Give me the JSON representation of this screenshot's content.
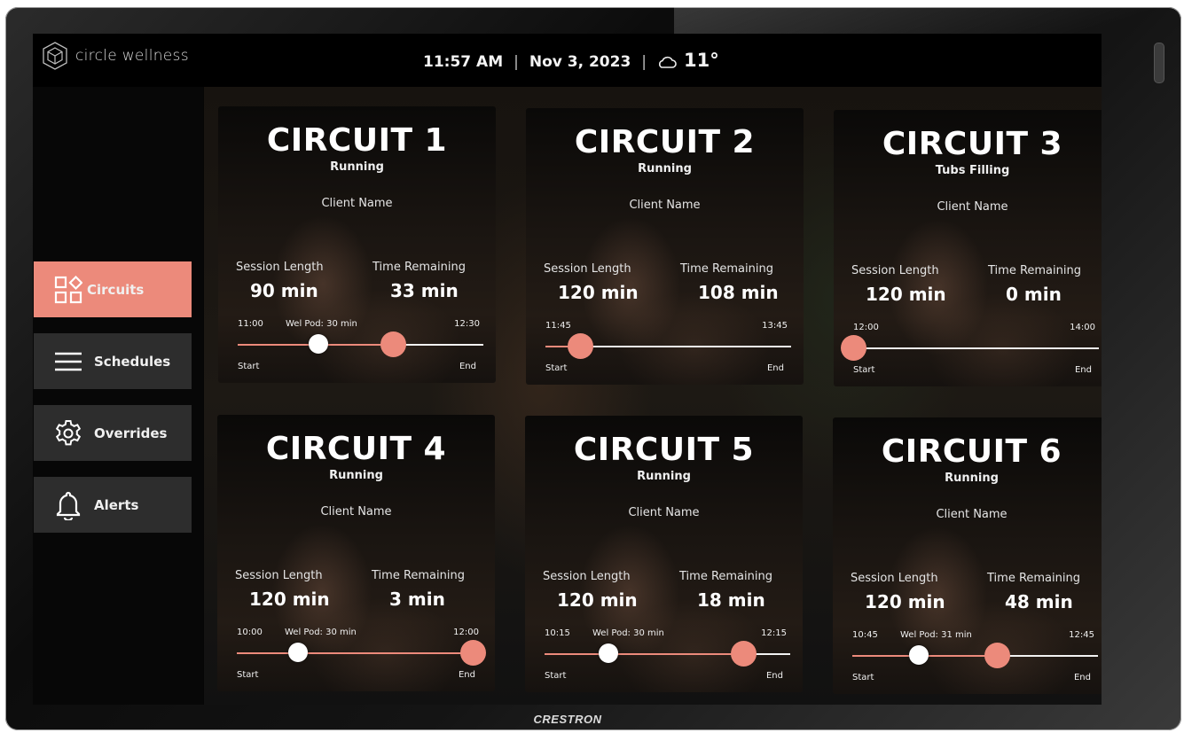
{
  "header": {
    "brand": "circle wellness",
    "time": "11:57 AM",
    "date": "Nov 3, 2023",
    "weather_icon": "cloud-icon",
    "temperature": "11°"
  },
  "sidebar": {
    "items": [
      {
        "label": "Circuits",
        "icon": "grid-icon",
        "active": true
      },
      {
        "label": "Schedules",
        "icon": "menu-icon",
        "active": false
      },
      {
        "label": "Overrides",
        "icon": "gear-icon",
        "active": false
      },
      {
        "label": "Alerts",
        "icon": "bell-icon",
        "active": false
      }
    ]
  },
  "labels": {
    "session_length": "Session Length",
    "time_remaining": "Time Remaining",
    "start": "Start",
    "end": "End"
  },
  "circuits": [
    {
      "title": "CIRCUIT 1",
      "status": "Running",
      "client": "Client Name",
      "session": "90 min",
      "remaining": "33 min",
      "start_time": "11:00",
      "end_time": "12:30",
      "pod": "Wel Pod: 30 min",
      "pod_marker": 0.33,
      "progress": 0.63
    },
    {
      "title": "CIRCUIT 2",
      "status": "Running",
      "client": "Client Name",
      "session": "120 min",
      "remaining": "108 min",
      "start_time": "11:45",
      "end_time": "13:45",
      "pod": "",
      "pod_marker": null,
      "progress": 0.14
    },
    {
      "title": "CIRCUIT 3",
      "status": "Tubs Filling",
      "client": "Client Name",
      "session": "120 min",
      "remaining": "0 min",
      "start_time": "12:00",
      "end_time": "14:00",
      "pod": "",
      "pod_marker": null,
      "progress": 0.0
    },
    {
      "title": "CIRCUIT 4",
      "status": "Running",
      "client": "Client Name",
      "session": "120 min",
      "remaining": "3 min",
      "start_time": "10:00",
      "end_time": "12:00",
      "pod": "Wel Pod: 30 min",
      "pod_marker": 0.25,
      "progress": 0.96
    },
    {
      "title": "CIRCUIT 5",
      "status": "Running",
      "client": "Client Name",
      "session": "120 min",
      "remaining": "18 min",
      "start_time": "10:15",
      "end_time": "12:15",
      "pod": "Wel Pod: 30 min",
      "pod_marker": 0.26,
      "progress": 0.81
    },
    {
      "title": "CIRCUIT 6",
      "status": "Running",
      "client": "Client Name",
      "session": "120 min",
      "remaining": "48 min",
      "start_time": "10:45",
      "end_time": "12:45",
      "pod": "Wel Pod: 31 min",
      "pod_marker": 0.27,
      "progress": 0.59
    }
  ],
  "colors": {
    "accent": "#ec8a7b",
    "panel": "#2d2d2d"
  },
  "device_brand": "CRESTRON"
}
